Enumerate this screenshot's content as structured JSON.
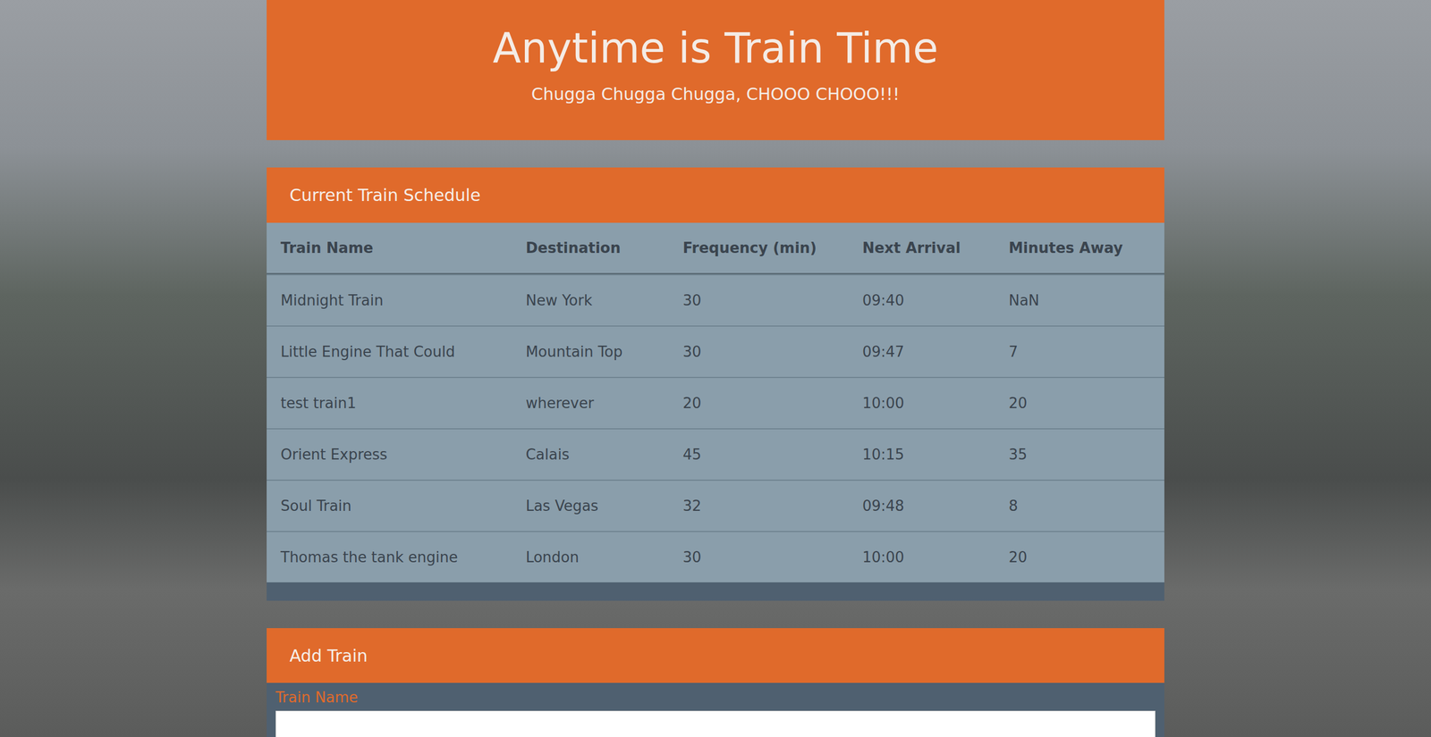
{
  "header": {
    "title": "Anytime is Train Time",
    "subtitle": "Chugga Chugga Chugga, CHOOO CHOOO!!!"
  },
  "schedule": {
    "title": "Current Train Schedule",
    "columns": [
      "Train Name",
      "Destination",
      "Frequency (min)",
      "Next Arrival",
      "Minutes Away"
    ],
    "rows": [
      [
        "Midnight Train",
        "New York",
        "30",
        "09:40",
        "NaN"
      ],
      [
        "Little Engine That Could",
        "Mountain Top",
        "30",
        "09:47",
        "7"
      ],
      [
        "test train1",
        "wherever",
        "20",
        "10:00",
        "20"
      ],
      [
        "Orient Express",
        "Calais",
        "45",
        "10:15",
        "35"
      ],
      [
        "Soul Train",
        "Las Vegas",
        "32",
        "09:48",
        "8"
      ],
      [
        "Thomas the tank engine",
        "London",
        "30",
        "10:00",
        "20"
      ]
    ]
  },
  "add_train": {
    "title": "Add Train",
    "fields": [
      {
        "label": "Train Name",
        "value": ""
      }
    ]
  }
}
